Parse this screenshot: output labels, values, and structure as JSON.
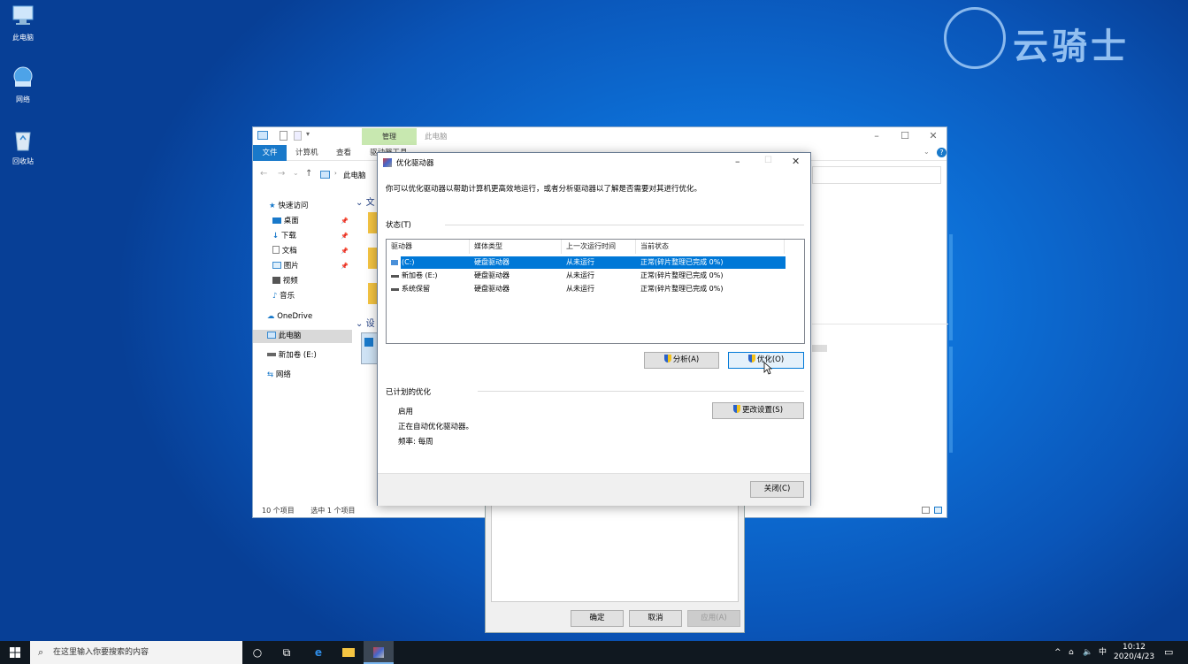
{
  "desktop": {
    "icons": [
      {
        "label": "此电脑"
      },
      {
        "label": "网络"
      },
      {
        "label": "回收站"
      }
    ],
    "watermark": "云骑士"
  },
  "explorer": {
    "context_tab": "管理",
    "title": "此电脑",
    "ribbon": {
      "file": "文件",
      "computer": "计算机",
      "view": "查看",
      "drive_tools": "驱动器工具"
    },
    "address": "此电脑",
    "nav": [
      {
        "label": "快速访问"
      },
      {
        "label": "桌面"
      },
      {
        "label": "下载"
      },
      {
        "label": "文档"
      },
      {
        "label": "图片"
      },
      {
        "label": "视频"
      },
      {
        "label": "音乐"
      },
      {
        "label": "OneDrive"
      },
      {
        "label": "此电脑"
      },
      {
        "label": "新加卷 (E:)"
      },
      {
        "label": "网络"
      }
    ],
    "section_folders": "文",
    "section_devices": "设",
    "status_count": "10 个项目",
    "status_selected": "选中 1 个项目"
  },
  "props_dialog": {
    "ok": "确定",
    "cancel": "取消",
    "apply": "应用(A)"
  },
  "optimize_dialog": {
    "title": "优化驱动器",
    "description": "你可以优化驱动器以帮助计算机更高效地运行，或者分析驱动器以了解是否需要对其进行优化。",
    "status_label": "状态(T)",
    "columns": [
      "驱动器",
      "媒体类型",
      "上一次运行时间",
      "当前状态"
    ],
    "rows": [
      {
        "drive": "(C:)",
        "media": "硬盘驱动器",
        "last_run": "从未运行",
        "status": "正常(碎片整理已完成 0%)"
      },
      {
        "drive": "新加卷 (E:)",
        "media": "硬盘驱动器",
        "last_run": "从未运行",
        "status": "正常(碎片整理已完成 0%)"
      },
      {
        "drive": "系统保留",
        "media": "硬盘驱动器",
        "last_run": "从未运行",
        "status": "正常(碎片整理已完成 0%)"
      }
    ],
    "analyze_button": "分析(A)",
    "optimize_button": "优化(O)",
    "scheduled_label": "已计划的优化",
    "scheduled_state": "启用",
    "scheduled_desc": "正在自动优化驱动器。",
    "scheduled_freq": "频率: 每周",
    "change_settings_button": "更改设置(S)",
    "close_button": "关闭(C)"
  },
  "taskbar": {
    "search_placeholder": "在这里输入你要搜索的内容",
    "ime": "中",
    "time": "10:12",
    "date": "2020/4/23"
  },
  "colors": {
    "accent": "#0078d7",
    "context_tab": "#c8e8b0",
    "taskbar": "#101820"
  }
}
